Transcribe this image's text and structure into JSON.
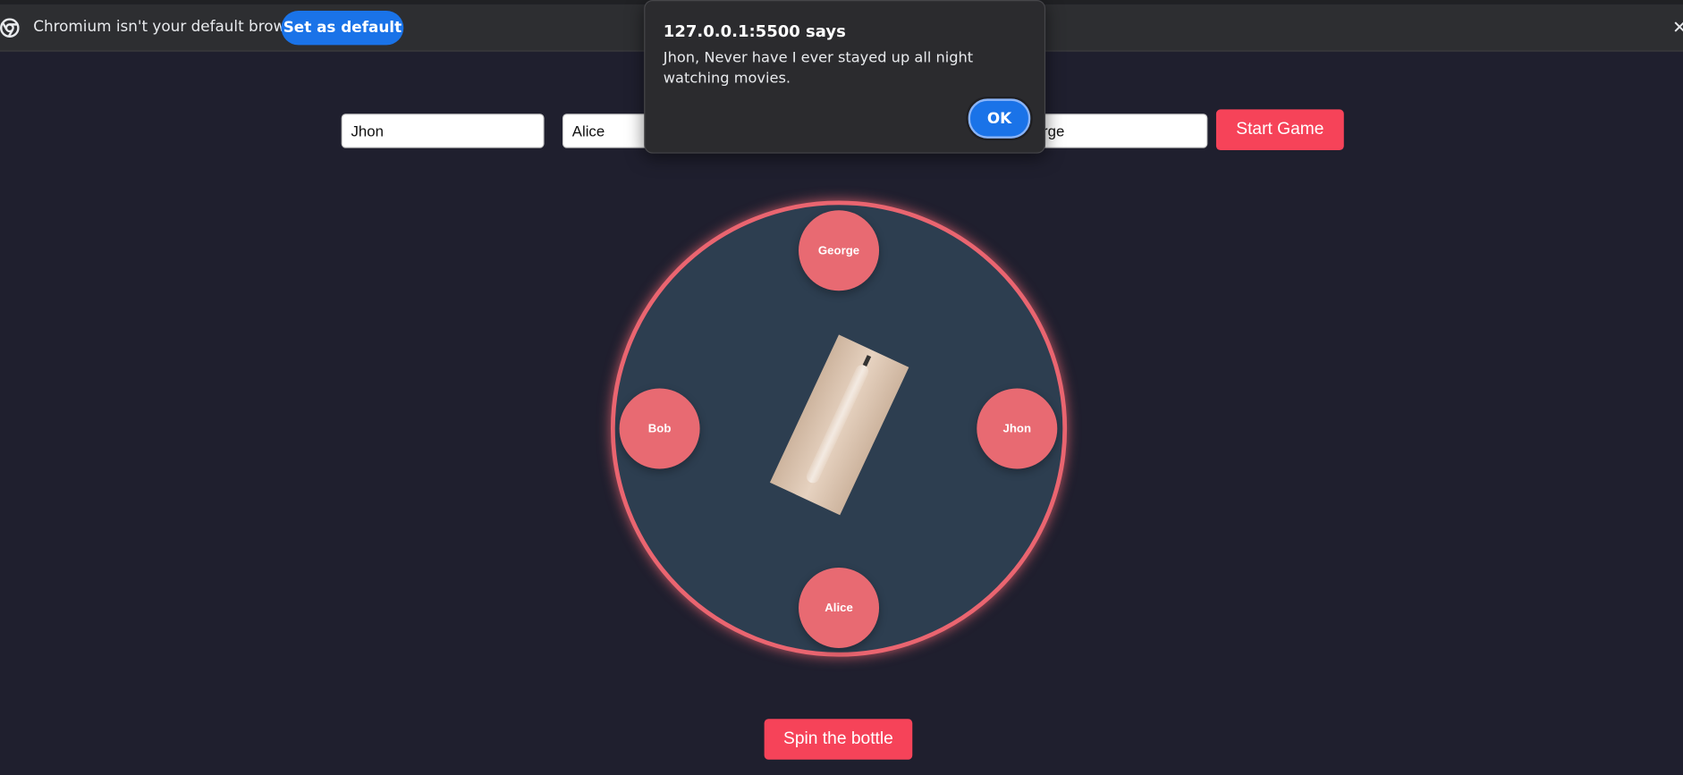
{
  "infobar": {
    "message": "Chromium isn't your default browser",
    "set_default_label": "Set as default",
    "close_glyph": "✕"
  },
  "inputs": {
    "player1": "Jhon",
    "player2": "Alice",
    "player4": "George"
  },
  "start_button_label": "Start Game",
  "players": {
    "top": "George",
    "left": "Bob",
    "right": "Jhon",
    "bottom": "Alice"
  },
  "spin_button_label": "Spin the bottle",
  "dialog": {
    "title": "127.0.0.1:5500 says",
    "message": "Jhon, Never have I ever stayed up all night watching movies.",
    "ok_label": "OK"
  },
  "colors": {
    "background": "#1f1f2e",
    "table": "#2d3e50",
    "accent": "#f64359",
    "player": "#e86a72",
    "chrome_blue": "#1a73e8"
  }
}
